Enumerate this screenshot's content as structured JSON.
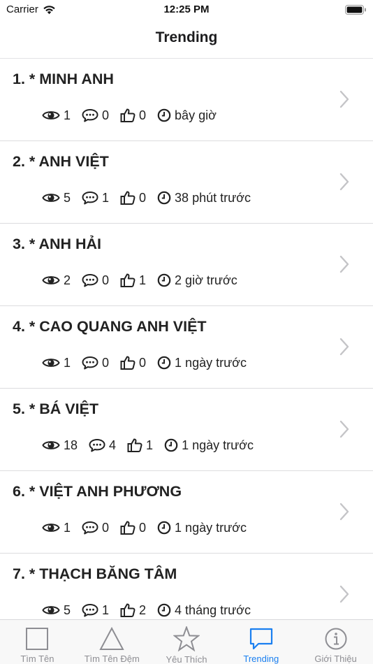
{
  "status_bar": {
    "carrier": "Carrier",
    "time": "12:25 PM"
  },
  "nav": {
    "title": "Trending"
  },
  "items": [
    {
      "title": "1. * MINH ANH",
      "views": "1",
      "comments": "0",
      "likes": "0",
      "time": "bây giờ"
    },
    {
      "title": "2. * ANH VIỆT",
      "views": "5",
      "comments": "1",
      "likes": "0",
      "time": "38 phút trước"
    },
    {
      "title": "3. * ANH HẢI",
      "views": "2",
      "comments": "0",
      "likes": "1",
      "time": "2 giờ trước"
    },
    {
      "title": "4. * CAO QUANG ANH VIỆT",
      "views": "1",
      "comments": "0",
      "likes": "0",
      "time": "1 ngày trước"
    },
    {
      "title": "5. * BÁ VIỆT",
      "views": "18",
      "comments": "4",
      "likes": "1",
      "time": "1 ngày trước"
    },
    {
      "title": "6. * VIỆT ANH PHƯƠNG",
      "views": "1",
      "comments": "0",
      "likes": "0",
      "time": "1 ngày trước"
    },
    {
      "title": "7. * THẠCH BĂNG TÂM",
      "views": "5",
      "comments": "1",
      "likes": "2",
      "time": "4 tháng trước"
    }
  ],
  "tabs": [
    {
      "label": "Tìm Tên",
      "icon": "square-icon"
    },
    {
      "label": "Tìm Tên Đệm",
      "icon": "triangle-icon"
    },
    {
      "label": "Yêu Thích",
      "icon": "star-icon"
    },
    {
      "label": "Trending",
      "icon": "chat-bubble-icon",
      "active": true
    },
    {
      "label": "Giới Thiệu",
      "icon": "info-icon"
    }
  ],
  "colors": {
    "accent": "#1a7ff0",
    "inactive": "#8e8e93",
    "text": "#222222"
  }
}
